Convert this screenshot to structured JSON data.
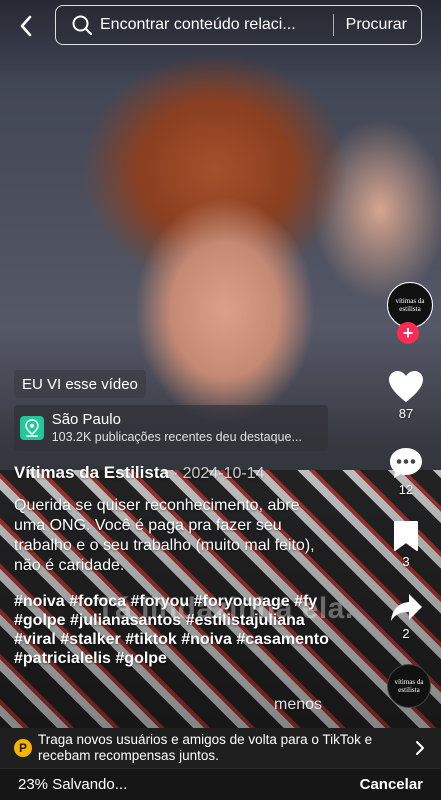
{
  "search": {
    "value": "Encontrar conteúdo relaci...",
    "button_label": "Procurar"
  },
  "video": {
    "burned_caption": "Tá lindazinha ela."
  },
  "badge": {
    "label": "EU VI esse vídeo"
  },
  "location": {
    "name": "São Paulo",
    "subtitle": "103.2K publicações recentes deu destaque..."
  },
  "post": {
    "author": "Vítimas da Estilista",
    "separator": "·",
    "date": "2024-10-14",
    "description": "Querida se quiser reconhecimento, abre uma ONG. Você é paga pra fazer seu trabalho e o seu trabalho (muito mal feito), não é caridade.",
    "hashtags": [
      "#noiva",
      "#fofoca",
      "#foryou",
      "#foryoupage",
      "#fy",
      "#golpe",
      "#julianasantos",
      "#estilistajuliana",
      "#viral",
      "#stalker",
      "#tiktok",
      "#noiva",
      "#casamento",
      "#patricialelis",
      "#golpe"
    ],
    "less_label": "menos"
  },
  "profile": {
    "avatar_text": "vítimas da estilista"
  },
  "actions": {
    "likes": "87",
    "comments": "12",
    "saves": "3",
    "shares": "2"
  },
  "music": {
    "disc_text": "vítimas da estilista"
  },
  "promo": {
    "icon_letter": "P",
    "text": "Traga novos usuários e amigos de volta para o TikTok e recebam recompensas juntos."
  },
  "savebar": {
    "status": "23% Salvando...",
    "cancel_label": "Cancelar"
  },
  "colors": {
    "accent": "#fe2c55",
    "promo_icon": "#f5b400",
    "location_icon": "#20c997"
  }
}
